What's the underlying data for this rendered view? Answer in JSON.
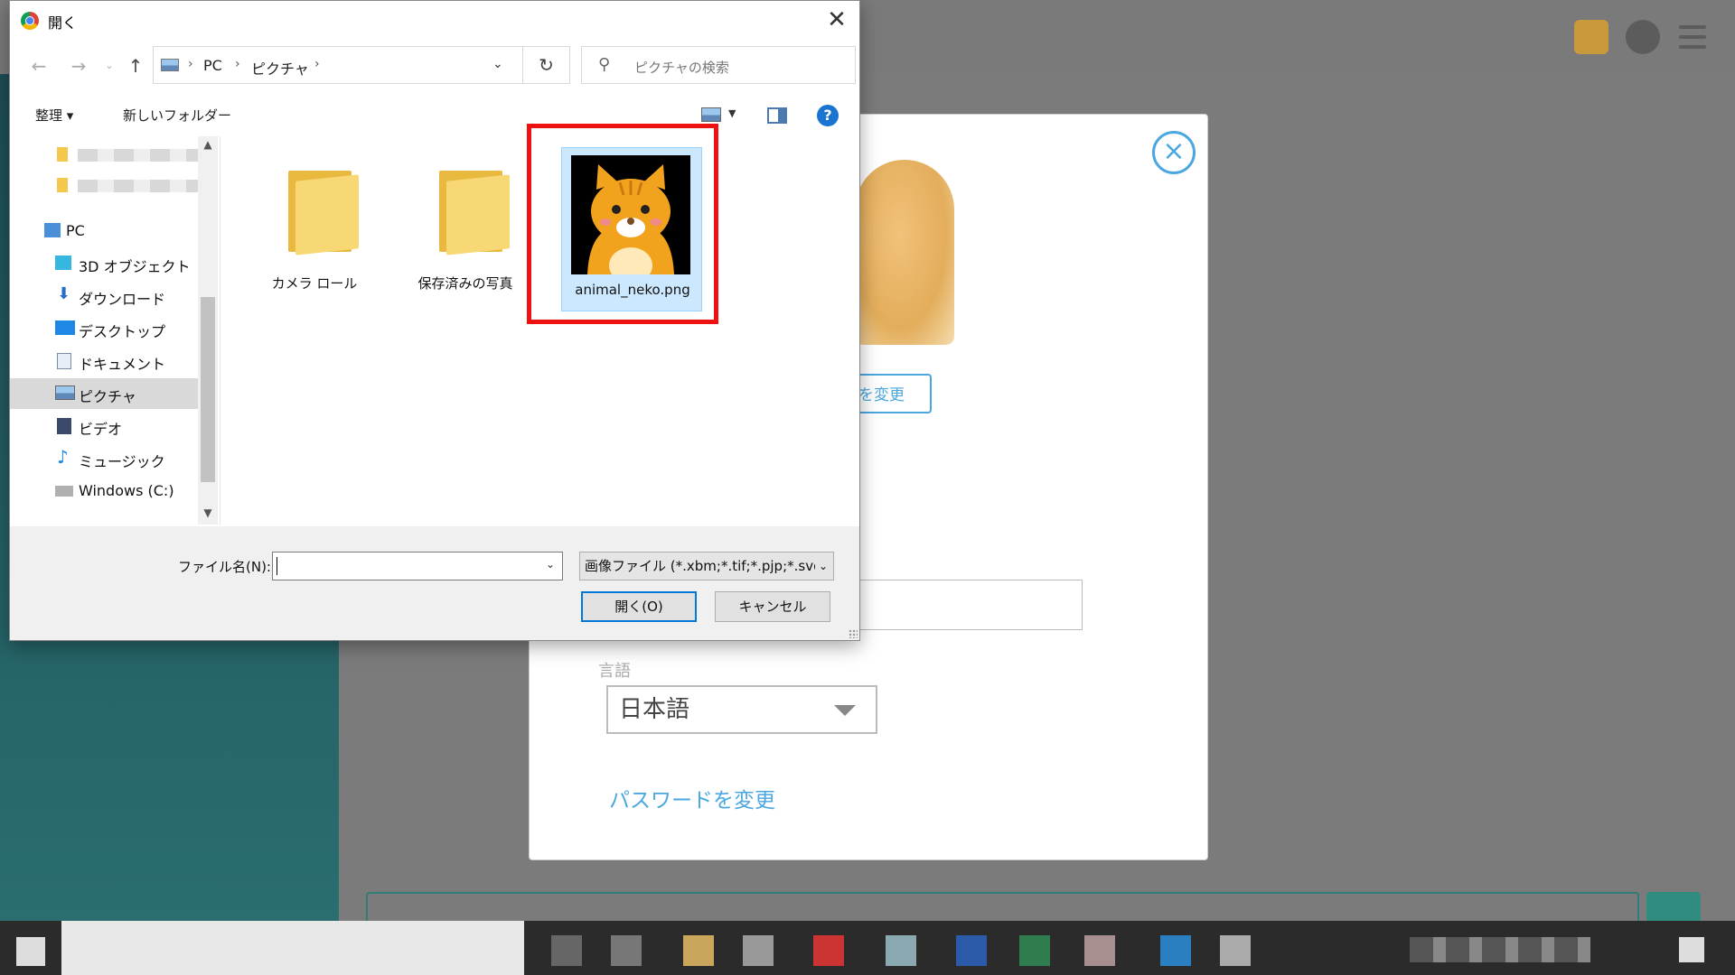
{
  "dialog": {
    "title": "開く",
    "address": [
      "PC",
      "ピクチャ"
    ],
    "search_placeholder": "ピクチャの検索",
    "toolbar": {
      "organize": "整理 ▾",
      "new_folder": "新しいフォルダー",
      "help": "?"
    },
    "nav_items": [
      {
        "label": "PC",
        "icon": "pc-icon"
      },
      {
        "label": "3D オブジェクト",
        "icon": "3d-objects-icon"
      },
      {
        "label": "ダウンロード",
        "icon": "download-icon"
      },
      {
        "label": "デスクトップ",
        "icon": "desktop-icon"
      },
      {
        "label": "ドキュメント",
        "icon": "document-icon"
      },
      {
        "label": "ピクチャ",
        "icon": "pictures-icon",
        "selected": true
      },
      {
        "label": "ビデオ",
        "icon": "video-icon"
      },
      {
        "label": "ミュージック",
        "icon": "music-icon"
      },
      {
        "label": "Windows (C:)",
        "icon": "drive-icon"
      }
    ],
    "files": [
      {
        "label": "カメラ ロール",
        "type": "folder"
      },
      {
        "label": "保存済みの写真",
        "type": "folder"
      },
      {
        "label": "animal_neko.png",
        "type": "image",
        "selected": true
      }
    ],
    "filename_label": "ファイル名(N):",
    "filename_value": "",
    "filetype": "画像ファイル (*.xbm;*.tif;*.pjp;*.svg",
    "open_button": "開く(O)",
    "cancel_button": "キャンセル"
  },
  "background": {
    "change_photo_label": "を変更",
    "language_label": "言語",
    "language_value": "日本語",
    "change_password_link": "パスワードを変更"
  },
  "colors": {
    "accent": "#4aa7e0",
    "highlight": "#ee1111",
    "selection": "#cce8ff",
    "teal": "#2f8c7e"
  }
}
